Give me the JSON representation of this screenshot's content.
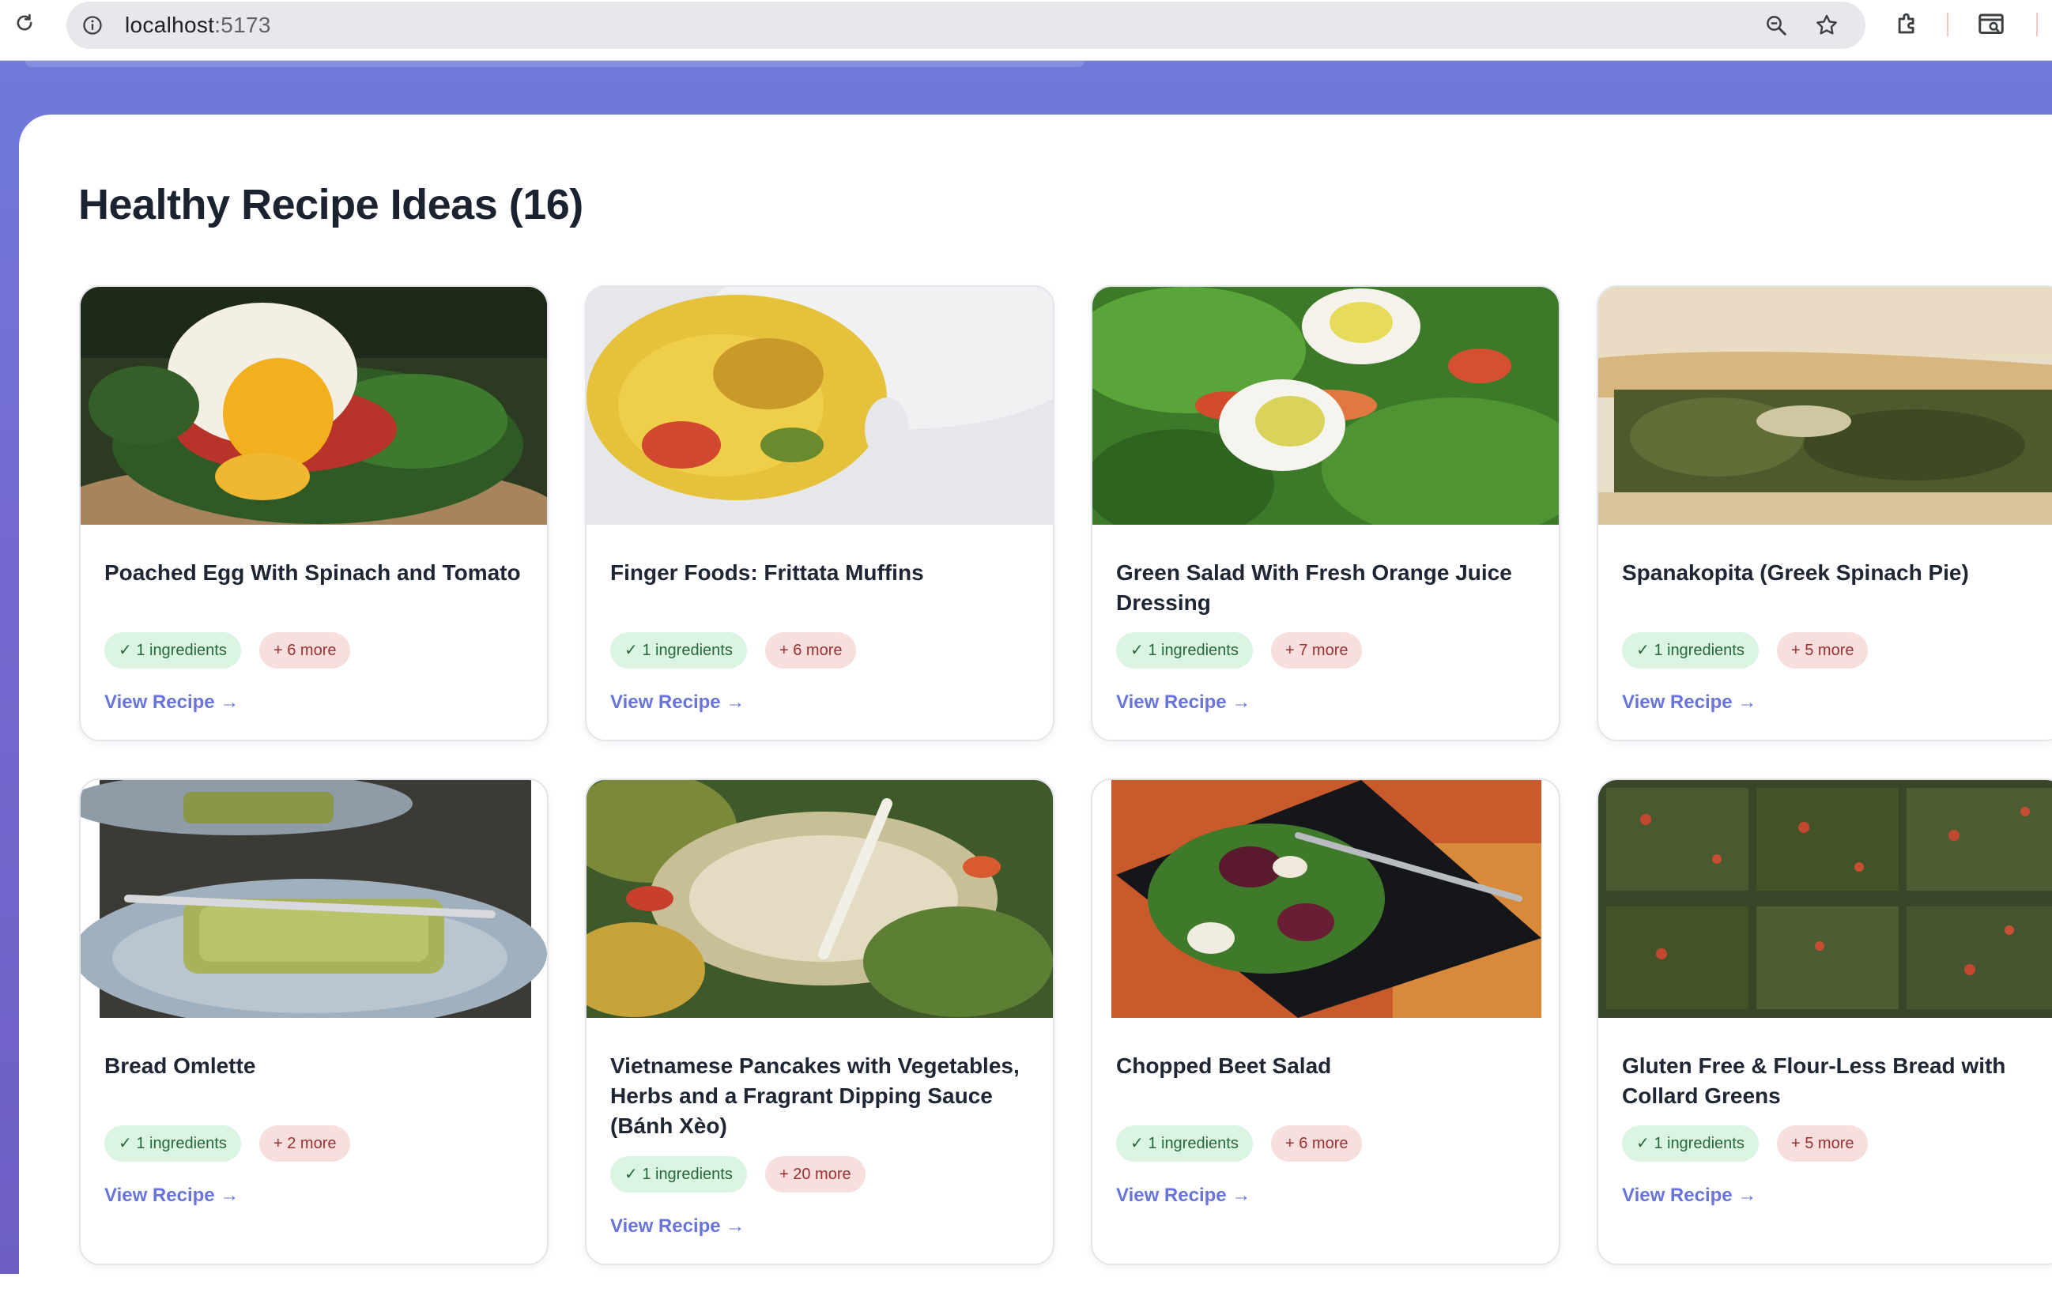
{
  "browser": {
    "url_host": "localhost",
    "url_port": ":5173"
  },
  "section": {
    "title": "Healthy Recipe Ideas (16)"
  },
  "recipes": [
    {
      "title": "Poached Egg With Spinach and Tomato",
      "matched": "✓ 1 ingredients",
      "more": "+ 6 more",
      "link": "View Recipe →"
    },
    {
      "title": "Finger Foods: Frittata Muffins",
      "matched": "✓ 1 ingredients",
      "more": "+ 6 more",
      "link": "View Recipe →"
    },
    {
      "title": "Green Salad With Fresh Orange Juice Dressing",
      "matched": "✓ 1 ingredients",
      "more": "+ 7 more",
      "link": "View Recipe →"
    },
    {
      "title": "Spanakopita (Greek Spinach Pie)",
      "matched": "✓ 1 ingredients",
      "more": "+ 5 more",
      "link": "View Recipe →"
    },
    {
      "title": "Bread Omlette",
      "matched": "✓ 1 ingredients",
      "more": "+ 2 more",
      "link": "View Recipe →"
    },
    {
      "title": "Vietnamese Pancakes with Vegetables, Herbs and a Fragrant Dipping Sauce (Bánh Xèo)",
      "matched": "✓ 1 ingredients",
      "more": "+ 20 more",
      "link": "View Recipe →"
    },
    {
      "title": "Chopped Beet Salad",
      "matched": "✓ 1 ingredients",
      "more": "+ 6 more",
      "link": "View Recipe →"
    },
    {
      "title": "Gluten Free & Flour-Less Bread with Collard Greens",
      "matched": "✓ 1 ingredients",
      "more": "+ 5 more",
      "link": "View Recipe →"
    }
  ],
  "colors": {
    "accent": "#6874d7",
    "matched_bg": "#dcf5e2",
    "more_bg": "#f9dede"
  }
}
